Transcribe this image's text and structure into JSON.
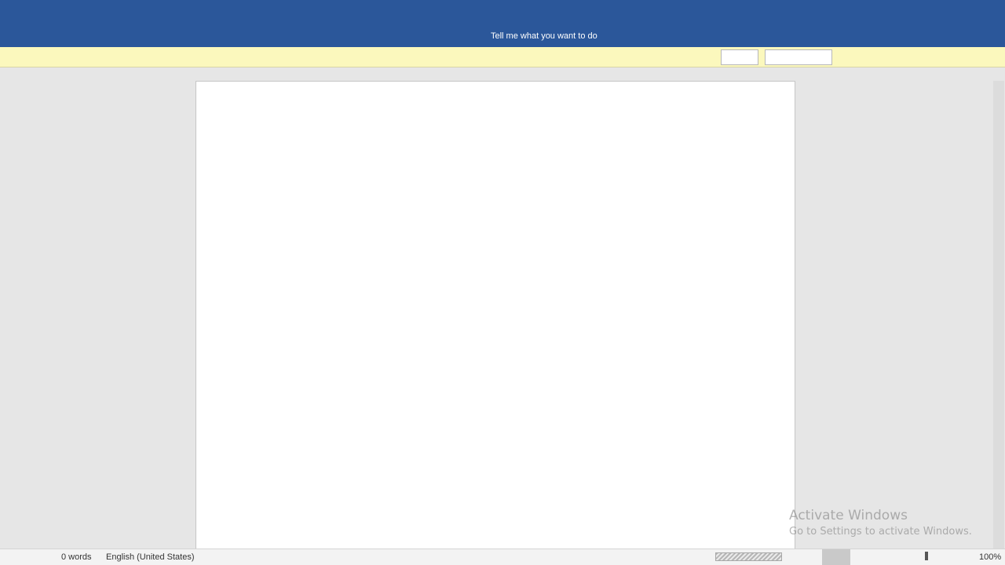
{
  "ribbon": {
    "tell_me": "Tell me what you want to do"
  },
  "message_bar": {
    "buttons": [
      "",
      ""
    ]
  },
  "watermark": {
    "line1": "Activate Windows",
    "line2": "Go to Settings to activate Windows."
  },
  "status_bar": {
    "word_count": "0 words",
    "language": "English (United States)",
    "zoom": "100%"
  },
  "colors": {
    "ribbon": "#2b579a",
    "message_bar": "#fbf8bd",
    "workspace": "#e6e6e6",
    "page": "#ffffff"
  }
}
